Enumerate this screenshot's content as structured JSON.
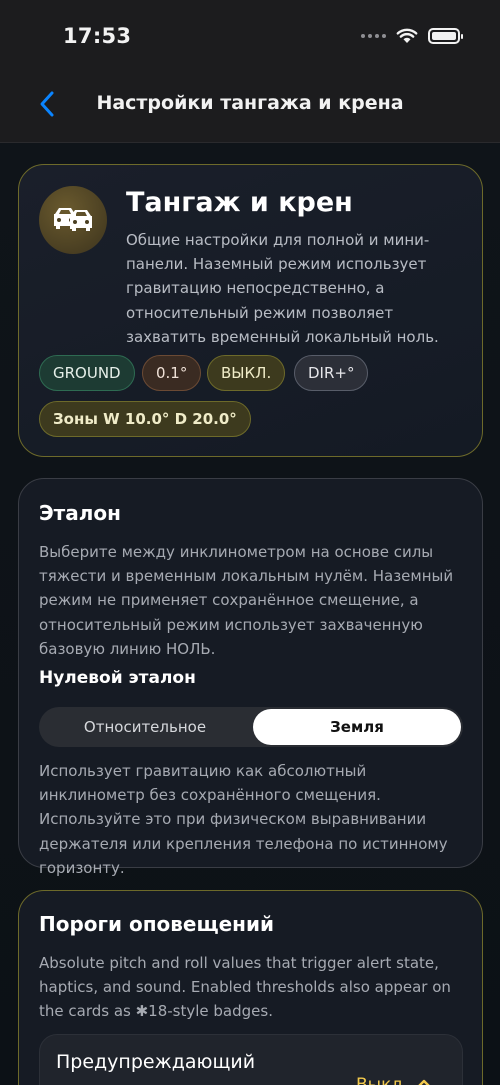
{
  "status_bar": {
    "time": "17:53"
  },
  "nav": {
    "title": "Настройки тангажа и крена"
  },
  "hero": {
    "title": "Тангаж и крен",
    "description": "Общие настройки для полной и мини-панели. Наземный режим использует гравитацию непосредственно, а относительный режим позволяет захватить временный локальный ноль.",
    "chips": {
      "mode": "GROUND",
      "deadband": "0.1°",
      "state": "ВЫКЛ.",
      "direction": "DIR+°",
      "zones": "Зоны W 10.0°  D 20.0°"
    }
  },
  "reference": {
    "title": "Эталон",
    "description": "Выберите между инклинометром на основе силы тяжести и временным локальным нулём. Наземный режим не применяет сохранённое смещение, а относительный режим использует захваченную базовую линию НОЛЬ.",
    "subtitle": "Нулевой эталон",
    "options": [
      "Относительное",
      "Земля"
    ],
    "selected": "Земля",
    "note": "Использует гравитацию как абсолютный инклинометр без сохранённого смещения. Используйте это при физическом выравнивании держателя или крепления телефона по истинному горизонту."
  },
  "alerts": {
    "title": "Пороги оповещений",
    "description": "Absolute pitch and roll values that trigger alert state, haptics, and sound. Enabled thresholds also appear on the cards as ✱18-style badges.",
    "warning": {
      "label": "Предупреждающий",
      "state": "Выкл."
    }
  },
  "colors": {
    "accent": "#0a84ff",
    "warning": "#f2c94c",
    "card_border_gold": "#6d6a2a"
  }
}
